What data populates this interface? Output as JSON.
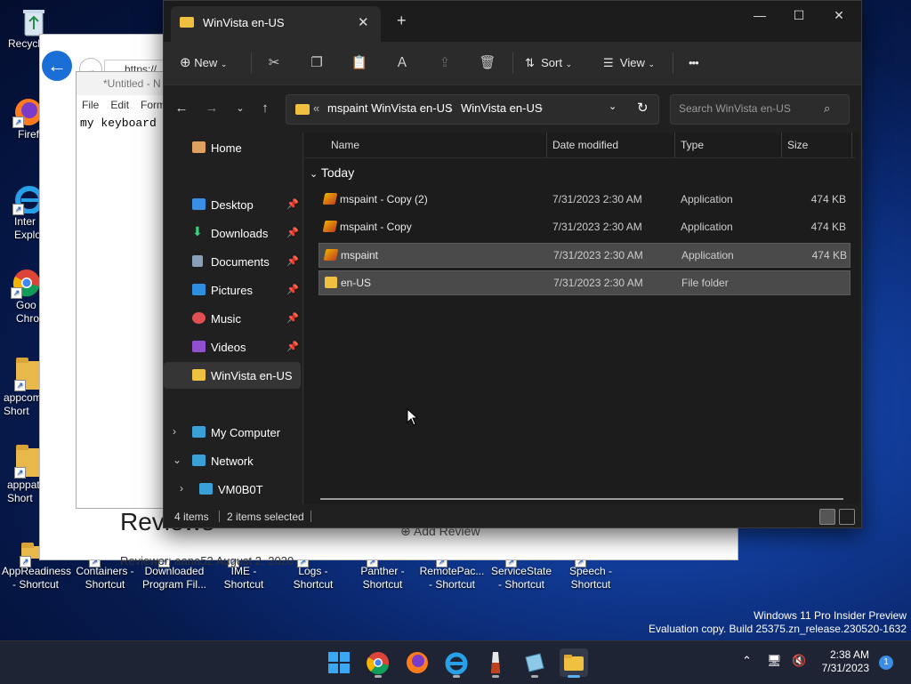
{
  "desktop": {
    "left_icons": [
      {
        "label": "Recycl"
      },
      {
        "label": "Firef"
      },
      {
        "label": "Inter Explo"
      },
      {
        "label": "Goo Chro"
      },
      {
        "label": "appcom Short"
      },
      {
        "label": "apppat Short"
      }
    ],
    "bottom_icons": [
      {
        "line1": "AppReadiness",
        "line2": "- Shortcut"
      },
      {
        "line1": "Containers -",
        "line2": "Shortcut"
      },
      {
        "line1": "Downloaded",
        "line2": "Program Fil..."
      },
      {
        "line1": "IME -",
        "line2": "Shortcut"
      },
      {
        "line1": "Logs -",
        "line2": "Shortcut"
      },
      {
        "line1": "Panther -",
        "line2": "Shortcut"
      },
      {
        "line1": "RemotePac...",
        "line2": "- Shortcut"
      },
      {
        "line1": "ServiceState",
        "line2": "- Shortcut"
      },
      {
        "line1": "Speech -",
        "line2": "Shortcut"
      }
    ],
    "watermark": {
      "line1": "Windows 11 Pro Insider Preview",
      "line2": "Evaluation copy. Build 25375.zn_release.230520-1632"
    }
  },
  "background": {
    "notepad_title": "*Untitled - N",
    "notepad_menu": [
      "File",
      "Edit",
      "Form"
    ],
    "notepad_text": "my keyboard",
    "browser_url": "https://",
    "browser_reviews": "Reviews",
    "browser_add_review": "Add Review",
    "browser_reviewer": "Reviewer: aana52    August 2, 2020"
  },
  "explorer": {
    "tab_title": "WinVista en-US",
    "toolbar": {
      "new": "New",
      "sort": "Sort",
      "view": "View",
      "more": "•••"
    },
    "address": {
      "prefix": "«",
      "crumb1": "mspaint WinVista en-US",
      "crumb2": "WinVista en-US",
      "sep": "›"
    },
    "search_placeholder": "Search WinVista en-US",
    "sidebar": {
      "home": "Home",
      "desktop": "Desktop",
      "downloads": "Downloads",
      "documents": "Documents",
      "pictures": "Pictures",
      "music": "Music",
      "videos": "Videos",
      "winvista": "WinVista en-US",
      "my_computer": "My Computer",
      "network": "Network",
      "vm": "VM0B0T"
    },
    "columns": {
      "name": "Name",
      "date": "Date modified",
      "type": "Type",
      "size": "Size"
    },
    "group": "Today",
    "files": [
      {
        "name": "mspaint - Copy (2)",
        "date": "7/31/2023 2:30 AM",
        "type": "Application",
        "size": "474 KB"
      },
      {
        "name": "mspaint - Copy",
        "date": "7/31/2023 2:30 AM",
        "type": "Application",
        "size": "474 KB"
      },
      {
        "name": "mspaint",
        "date": "7/31/2023 2:30 AM",
        "type": "Application",
        "size": "474 KB"
      },
      {
        "name": "en-US",
        "date": "7/31/2023 2:30 AM",
        "type": "File folder",
        "size": ""
      }
    ],
    "status": {
      "count": "4 items",
      "selected": "2 items selected"
    }
  },
  "taskbar": {
    "time": "2:38 AM",
    "date": "7/31/2023",
    "notification_count": "1"
  }
}
